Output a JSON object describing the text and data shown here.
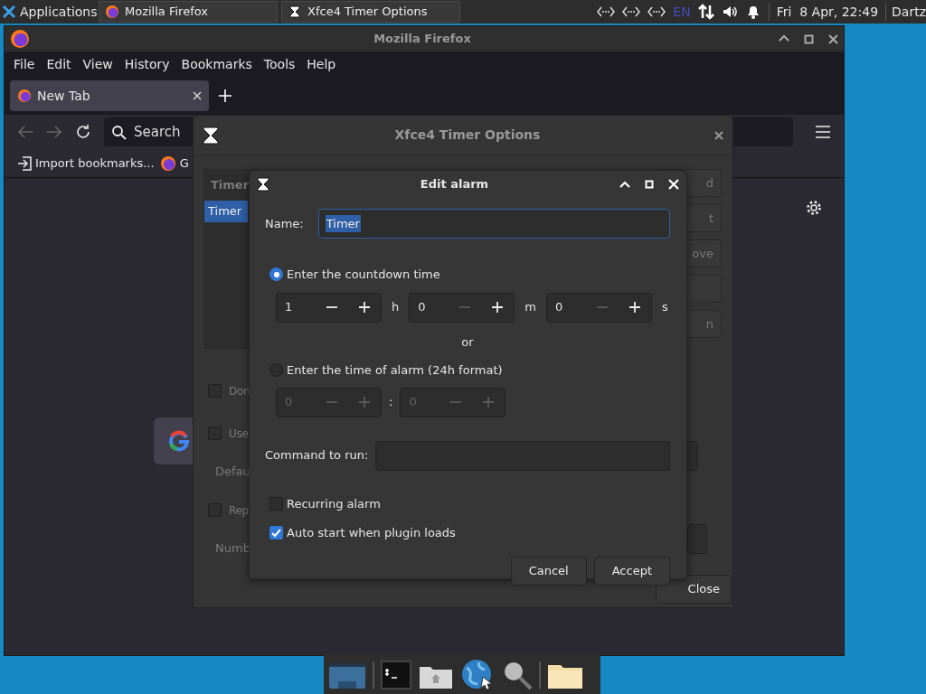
{
  "panel": {
    "apps_menu": "Applications",
    "tasks": [
      {
        "label": "Mozilla Firefox",
        "kind": "firefox"
      },
      {
        "label": "Xfce4 Timer Options",
        "kind": "timer"
      }
    ],
    "keyboard_layout": "EN",
    "clock": "Fri  8 Apr, 22:49",
    "user": "Dartz"
  },
  "firefox": {
    "title": "Mozilla Firefox",
    "menu": [
      "File",
      "Edit",
      "View",
      "History",
      "Bookmarks",
      "Tools",
      "Help"
    ],
    "tabs": [
      {
        "label": "New Tab",
        "selected": true
      }
    ],
    "back_disabled": true,
    "forward_disabled": true,
    "search": {
      "placeholder": "Search"
    },
    "bookmarks": [
      {
        "label": "Import bookmarks...",
        "kind": "import"
      },
      {
        "label": "G",
        "kind": "firefox"
      }
    ]
  },
  "timer_options": {
    "title": "Xfce4 Timer Options",
    "list_header": "Timer",
    "list_rows": [
      {
        "label": "Timer",
        "selected": true
      }
    ],
    "side_buttons": [
      {
        "kind": "text",
        "label": "d"
      },
      {
        "kind": "text",
        "label": "t"
      },
      {
        "kind": "text",
        "label": "ove"
      },
      {
        "kind": "blank"
      },
      {
        "kind": "text",
        "label": "n"
      }
    ],
    "options": [
      {
        "kind": "checkbox",
        "label": "Don",
        "checked": false
      },
      {
        "kind": "checkbox",
        "label": "Use",
        "checked": false
      },
      {
        "kind": "hint",
        "label": "Defau"
      },
      {
        "kind": "checkbox",
        "label": "Rep",
        "checked": false
      },
      {
        "kind": "hint",
        "label": "Numb"
      }
    ],
    "close_button": "Close"
  },
  "edit_alarm": {
    "title": "Edit alarm",
    "name_label": "Name:",
    "name_value": "Timer",
    "countdown": {
      "label": "Enter the countdown time",
      "selected": true,
      "spins": [
        {
          "value": "1",
          "unit": "h",
          "minus_disabled": false
        },
        {
          "value": "0",
          "unit": "m",
          "minus_disabled": true
        },
        {
          "value": "0",
          "unit": "s",
          "minus_disabled": true
        }
      ]
    },
    "or": "or",
    "alarm_time": {
      "label": "Enter the time of alarm (24h format)",
      "selected": false,
      "disabled": true,
      "spins": [
        {
          "value": "0"
        },
        {
          "value": "0"
        }
      ],
      "separator": ":"
    },
    "command_label": "Command to run:",
    "checks": [
      {
        "label": "Recurring alarm",
        "checked": false
      },
      {
        "label": "Auto start when plugin loads",
        "checked": true
      }
    ],
    "buttons": [
      "Cancel",
      "Accept"
    ]
  }
}
